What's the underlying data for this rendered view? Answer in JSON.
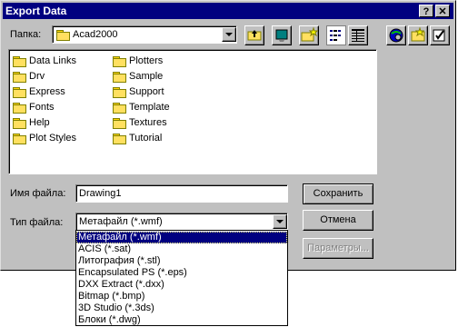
{
  "title": "Export Data",
  "title_buttons": [
    "?",
    "✕"
  ],
  "folder_label": "Папка:",
  "folder_value": "Acad2000",
  "toolbar_icons": [
    "up-folder-icon",
    "desktop-icon",
    "new-folder-icon",
    "list-view-icon",
    "details-view-icon"
  ],
  "extra_icons": [
    "find-file-icon",
    "locate-icon",
    "options-icon"
  ],
  "files_col1": [
    "Data Links",
    "Drv",
    "Express",
    "Fonts",
    "Help",
    "Plot Styles"
  ],
  "files_col2": [
    "Plotters",
    "Sample",
    "Support",
    "Template",
    "Textures",
    "Tutorial"
  ],
  "filename_label": "Имя файла:",
  "filename_value": "Drawing1",
  "filetype_label": "Тип файла:",
  "filetype_value": "Метафайл (*.wmf)",
  "save_button": "Сохранить",
  "cancel_button": "Отмена",
  "params_button": "Параметры...",
  "filetype_options": [
    "Метафайл (*.wmf)",
    "ACIS (*.sat)",
    "Литография (*.stl)",
    "Encapsulated PS (*.eps)",
    "DXX Extract (*.dxx)",
    "Bitmap (*.bmp)",
    "3D Studio (*.3ds)",
    "Блоки (*.dwg)"
  ],
  "selected_option_index": 0
}
